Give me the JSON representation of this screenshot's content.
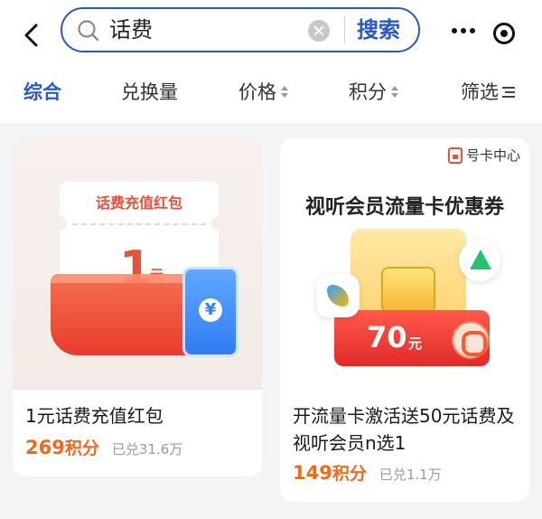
{
  "search": {
    "query": "话费",
    "button_label": "搜索"
  },
  "tabs": [
    {
      "label": "综合",
      "active": true
    },
    {
      "label": "兑换量",
      "active": false
    },
    {
      "label": "价格",
      "active": false,
      "sortable": true
    },
    {
      "label": "积分",
      "active": false,
      "sortable": true
    },
    {
      "label": "筛选",
      "active": false,
      "filter": true
    }
  ],
  "products": [
    {
      "title": "1元话费充值红包",
      "points": "269",
      "points_unit": "积分",
      "exchanged": "已兑31.6万",
      "image": {
        "ticket_title": "话费充值红包",
        "amount": "1",
        "unit": "元",
        "phone_symbol": "¥"
      }
    },
    {
      "title": "开流量卡激活送50元话费及视听会员n选1",
      "points": "149",
      "points_unit": "积分",
      "exchanged": "已兑1.1万",
      "image": {
        "badge": "号卡中心",
        "headline": "视听会员流量卡优惠券",
        "amount": "70",
        "unit": "元"
      }
    }
  ],
  "colors": {
    "accent": "#2a58c9",
    "points": "#ee6a1c",
    "muted": "#999999"
  },
  "icons": {
    "back": "chevron-left-icon",
    "search": "search-icon",
    "clear": "clear-icon",
    "more": "more-icon",
    "target": "target-icon",
    "sort": "sort-icon",
    "filter": "filter-icon"
  }
}
